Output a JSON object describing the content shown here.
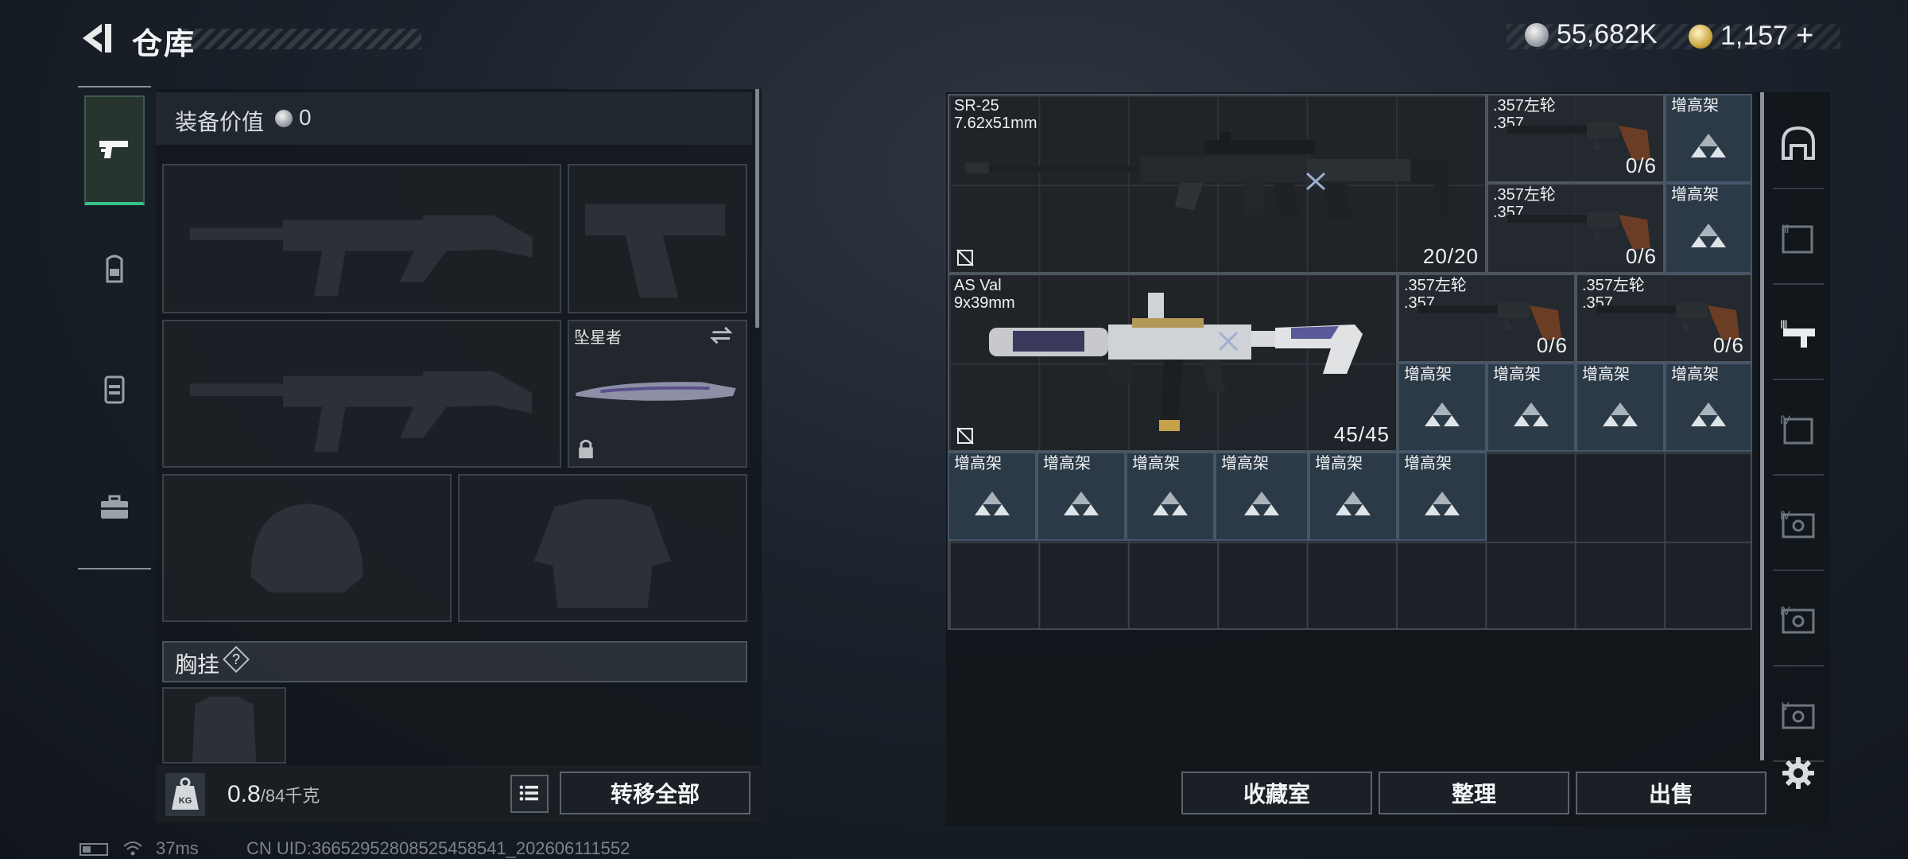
{
  "header": {
    "title": "仓库",
    "currency_silver": "55,682K",
    "currency_gold": "1,157",
    "currency_gold_plus": "+"
  },
  "equipment": {
    "value_label": "装备价值",
    "value": "0",
    "melee_name": "坠星者",
    "vest_label": "胸挂",
    "vest_help": "?"
  },
  "weight": {
    "current": "0.8",
    "max": "/84千克",
    "icon_text": "KG"
  },
  "buttons": {
    "transfer_all": "转移全部",
    "collection_room": "收藏室",
    "organize": "整理",
    "sell": "出售"
  },
  "storage_items": [
    {
      "name": "SR-25",
      "caliber": "7.62x51mm",
      "ammo": "20/20"
    },
    {
      "name": "AS Val",
      "caliber": "9x39mm",
      "ammo": "45/45"
    },
    {
      "name": ".357左轮",
      "caliber": ".357",
      "ammo": "0/6"
    },
    {
      "name": ".357左轮",
      "caliber": ".357",
      "ammo": "0/6"
    },
    {
      "name": ".357左轮",
      "caliber": ".357",
      "ammo": "0/6"
    },
    {
      "name": ".357左轮",
      "caliber": ".357",
      "ammo": "0/6"
    }
  ],
  "rack_label": "增高架",
  "status_bar": {
    "ping": "37ms",
    "uid": "CN UID:36652952808525458541_202606111552"
  },
  "colors": {
    "active_tab_accent": "#38c28a",
    "rack_bg": "#2c3a48",
    "panel_bg": "#12171c"
  },
  "icons": {
    "back": "back-arrow-icon",
    "tabs": [
      "pistol-icon",
      "backpack-icon",
      "vest-icon",
      "briefcase-icon"
    ],
    "categories": [
      "helmet-icon",
      "tier-3-armor-icon",
      "tier-3-weapon-icon",
      "tier-4-case-icon",
      "tier-4-safe-icon",
      "tier-4-safe-icon",
      "tier-5-safe-icon"
    ],
    "settings": "gear-icon"
  }
}
